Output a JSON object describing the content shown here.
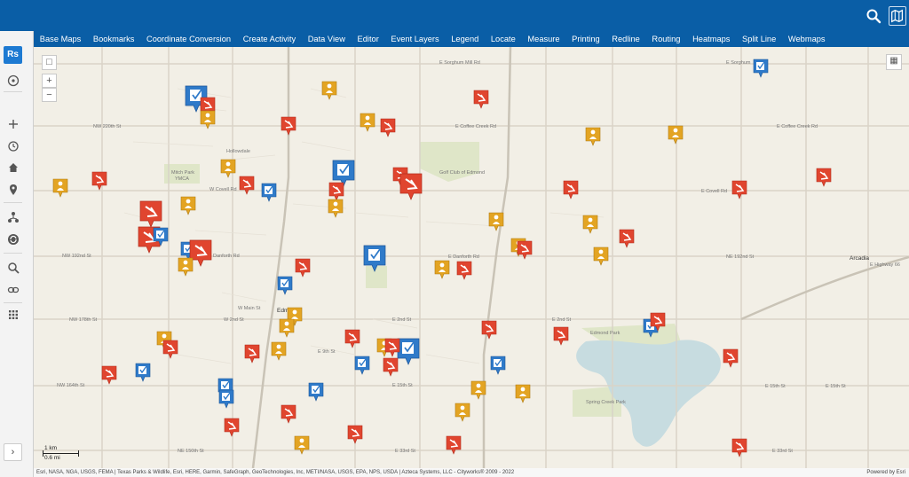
{
  "toolbar": {
    "search_icon": "search-icon",
    "map_icon": "map-icon"
  },
  "menu": {
    "items": [
      "Base Maps",
      "Bookmarks",
      "Coordinate Conversion",
      "Create Activity",
      "Data View",
      "Editor",
      "Event Layers",
      "Legend",
      "Locate",
      "Measure",
      "Printing",
      "Redline",
      "Routing",
      "Heatmaps",
      "Split Line",
      "Webmaps"
    ]
  },
  "sidebar": {
    "logo": "Rs",
    "icons": [
      "dashboard-icon",
      "plus-icon",
      "history-icon",
      "home-icon",
      "location-pin-icon",
      "workflow-icon",
      "sync-icon",
      "search-icon",
      "link-icon",
      "grid-icon"
    ],
    "expand_label": "›"
  },
  "map": {
    "zoom_in": "+",
    "zoom_out": "−",
    "select_box": "□",
    "basemap_toggle": "▦",
    "scale": {
      "km": "1 km",
      "mi": "0.6 mi"
    },
    "labels": {
      "hollowdale": "Hollowdale",
      "mitch_park": "Mitch Park",
      "ymca": "YMCA",
      "golf_club": "Golf Club of Edmond",
      "edmond": "Edmond",
      "edmond_park": "Edmond Park",
      "spring_creek_park": "Spring Creek Park",
      "arcadia": "Arcadia",
      "e_sorghum_mill": "E Sorghum Mill Rd",
      "e_sorghum": "E Sorghum",
      "nw_220th": "NW 220th St",
      "e_coffee_creek": "E Coffee Creek Rd",
      "e_coffee_creek_2": "E Coffee Creek Rd",
      "w_covell": "W Covell Rd",
      "e_covell": "E Covell Rd",
      "nw_192nd": "NW 192nd St",
      "danforth_w": "Danforth Rd",
      "e_danforth": "E Danforth Rd",
      "ne_192nd": "NE 192nd St",
      "highway_66": "E Highway 66",
      "w_main": "W Main St",
      "e_2nd": "E 2nd St",
      "e_2nd_2": "E 2nd St",
      "nw_178th": "NW 178th St",
      "w_2nd": "W 2nd St",
      "nw_164th": "NW 164th St",
      "e_9th": "E 9th St",
      "e_15th": "E 15th St",
      "e_15th_2": "E 15th St",
      "e_15th_3": "E 15th St",
      "ne_150th": "NE 150th St",
      "e_33rd": "E 33rd St",
      "e_33rd_2": "E 33rd St"
    }
  },
  "attribution": {
    "text": "Esri, NASA, NGA, USGS, FEMA | Texas Parks & Wildlife, Esri, HERE, Garmin, SafeGraph, GeoTechnologies, Inc, METI/NASA, USGS, EPA, NPS, USDA | Azteca Systems, LLC - Cityworks® 2009 - 2022",
    "powered": "Powered by Esri"
  }
}
